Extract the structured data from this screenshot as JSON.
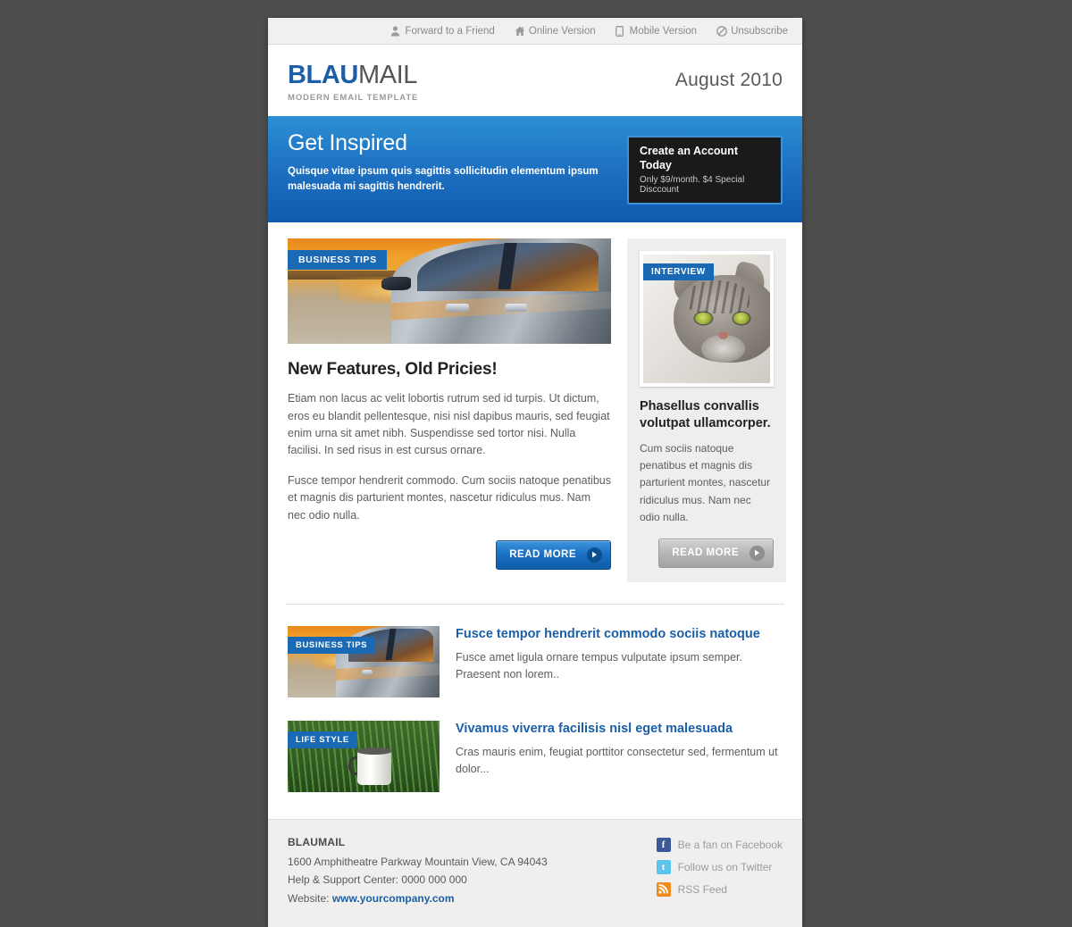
{
  "preheader": {
    "links": [
      {
        "label": "Forward to a Friend",
        "icon": "person-icon"
      },
      {
        "label": "Online Version",
        "icon": "home-icon"
      },
      {
        "label": "Mobile Version",
        "icon": "mobile-icon"
      },
      {
        "label": "Unsubscribe",
        "icon": "block-icon"
      }
    ]
  },
  "masthead": {
    "logo_primary": "BLAU",
    "logo_secondary": "MAIL",
    "tagline": "MODERN EMAIL TEMPLATE",
    "issue_date": "August 2010"
  },
  "hero": {
    "title": "Get Inspired",
    "subtitle": "Quisque vitae ipsum quis sagittis sollicitudin elementum ipsum malesuada mi sagittis hendrerit.",
    "cta_title": "Create an Account Today",
    "cta_subtitle": "Only $9/month. $4 Special Disccount",
    "bg_color": "#1d6fc0",
    "cta_border_color": "#3e92d8"
  },
  "feature": {
    "badge": "BUSINESS TIPS",
    "image_alt": "silver-car-at-sunset-beach",
    "headline": "New Features, Old Pricies!",
    "paragraph1": "Etiam non lacus ac velit lobortis rutrum sed id turpis. Ut dictum, eros eu blandit pellentesque, nisi nisl dapibus mauris, sed feugiat enim urna sit amet nibh. Suspendisse sed tortor nisi. Nulla facilisi. In sed risus in est cursus ornare.",
    "paragraph2": "Fusce tempor hendrerit commodo. Cum sociis natoque penatibus et magnis dis parturient montes, nascetur ridiculus mus. Nam nec odio nulla.",
    "read_more": "READ MORE"
  },
  "sidebar": {
    "badge": "INTERVIEW",
    "image_alt": "tabby-cat-portrait",
    "title": "Phasellus convallis volutpat ullamcorper.",
    "body": "Cum sociis natoque penatibus et magnis dis parturient montes, nascetur ridiculus mus. Nam nec odio nulla.",
    "read_more": "READ MORE"
  },
  "articles": [
    {
      "badge": "BUSINESS TIPS",
      "image_alt": "silver-car-at-sunset-beach",
      "title": "Fusce tempor hendrerit commodo sociis natoque",
      "excerpt": "Fusce amet ligula ornare tempus vulputate ipsum semper. Praesent non lorem.."
    },
    {
      "badge": "LIFE STYLE",
      "image_alt": "white-mug-in-green-grass",
      "title": "Vivamus viverra facilisis nisl eget malesuada",
      "excerpt": "Cras mauris enim, feugiat porttitor consectetur sed, fermentum ut dolor..."
    }
  ],
  "footer": {
    "company": "BLAUMAIL",
    "address": "1600 Amphitheatre Parkway Mountain View, CA 94043",
    "support": "Help & Support Center: 0000 000 000",
    "website_label": "Website:",
    "website_url": "www.yourcompany.com",
    "social": [
      {
        "label": "Be a fan on Facebook",
        "icon": "facebook-icon",
        "glyph": "f",
        "color": "#3b5998"
      },
      {
        "label": "Follow us on Twitter",
        "icon": "twitter-icon",
        "glyph": "t",
        "color": "#5bc3ec"
      },
      {
        "label": "RSS Feed",
        "icon": "rss-icon",
        "glyph": "",
        "color": "#f08a1c"
      }
    ]
  }
}
